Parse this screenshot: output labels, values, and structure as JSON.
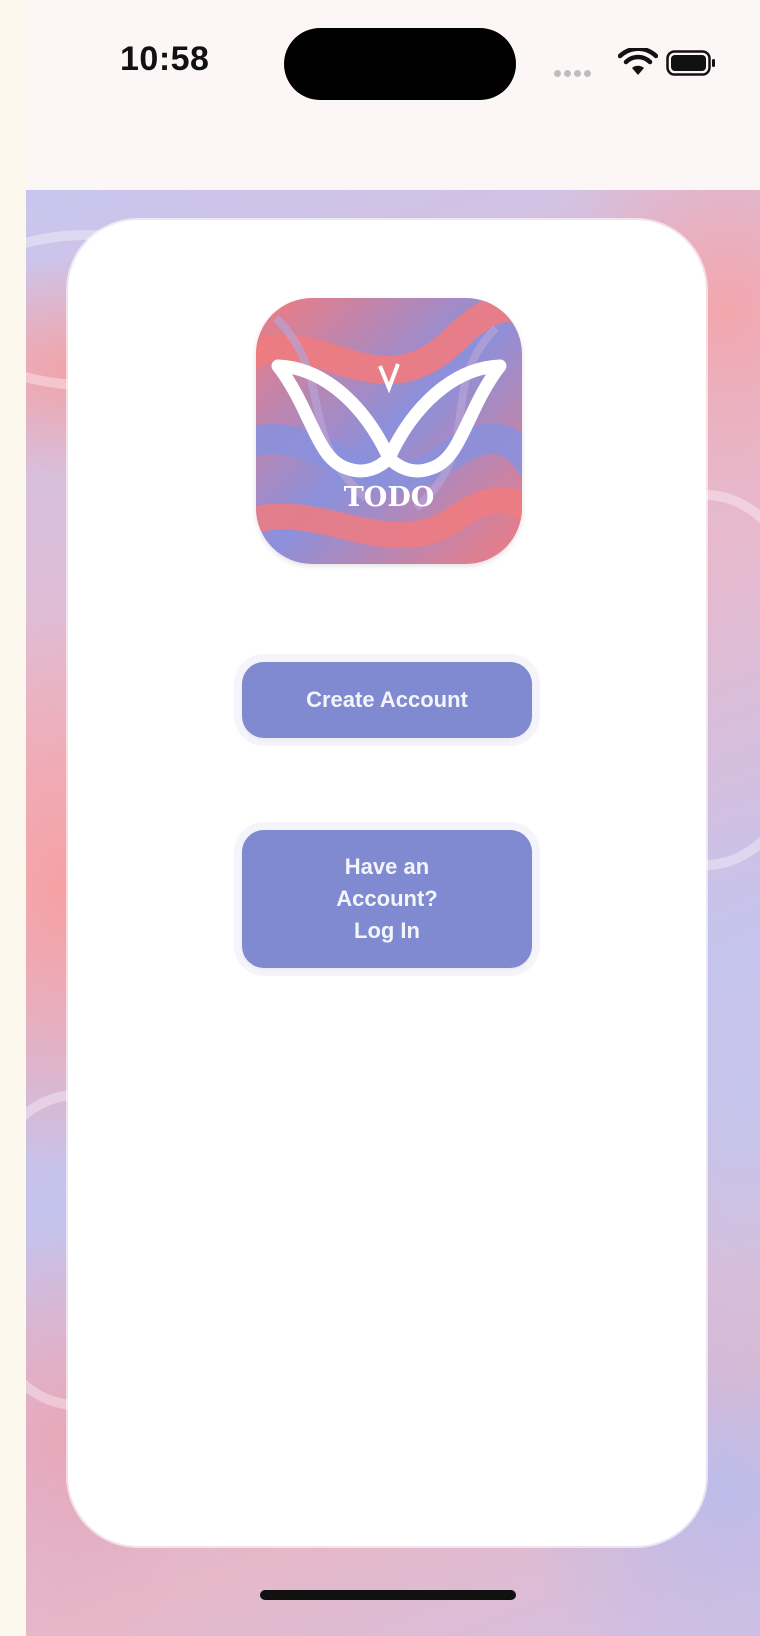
{
  "status_bar": {
    "time": "10:58",
    "icons": [
      "signal-dots-icon",
      "wifi-icon",
      "battery-icon"
    ]
  },
  "logo": {
    "text": "TODO",
    "icon": "butterfly-logo-icon"
  },
  "buttons": {
    "create_account": "Create Account",
    "login_line1": "Have an",
    "login_line2": "Account?",
    "login_line3": "Log In"
  },
  "colors": {
    "button": "#808ad1",
    "logo_coral": "#f07b80",
    "logo_periwinkle": "#8b90dc"
  }
}
